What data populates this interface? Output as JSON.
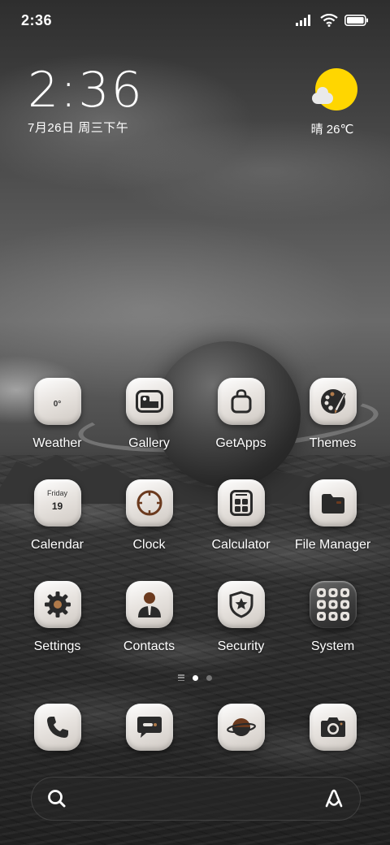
{
  "status_bar": {
    "time": "2:36",
    "icons": [
      "signal-icon",
      "wifi-icon",
      "battery-icon"
    ]
  },
  "clock_widget": {
    "time": "2:36",
    "date": "7月26日 周三下午"
  },
  "weather_widget": {
    "text": "晴 26℃",
    "icon": "sun-cloud-icon"
  },
  "apps": [
    {
      "label": "Weather",
      "icon": "weather-icon",
      "icon_text": "0°"
    },
    {
      "label": "Gallery",
      "icon": "gallery-icon"
    },
    {
      "label": "GetApps",
      "icon": "shopping-bag-icon"
    },
    {
      "label": "Themes",
      "icon": "palette-icon"
    },
    {
      "label": "Calendar",
      "icon": "calendar-icon",
      "day": "Friday",
      "date": "19"
    },
    {
      "label": "Clock",
      "icon": "clock-icon"
    },
    {
      "label": "Calculator",
      "icon": "calculator-icon"
    },
    {
      "label": "File Manager",
      "icon": "folder-icon"
    },
    {
      "label": "Settings",
      "icon": "gear-icon"
    },
    {
      "label": "Contacts",
      "icon": "person-icon"
    },
    {
      "label": "Security",
      "icon": "shield-star-icon"
    },
    {
      "label": "System",
      "icon": "app-folder-icon"
    }
  ],
  "page_indicator": {
    "pages": 2,
    "active": 0
  },
  "dock": [
    {
      "name": "phone",
      "icon": "phone-icon"
    },
    {
      "name": "messages",
      "icon": "message-icon"
    },
    {
      "name": "browser",
      "icon": "planet-icon"
    },
    {
      "name": "camera",
      "icon": "camera-icon"
    }
  ],
  "search_bar": {
    "left_icon": "search-icon",
    "right_icon": "assistant-icon"
  },
  "colors": {
    "sun": "#ffd600",
    "icon_glyph": "#2a2a2a",
    "icon_accent": "#6b3a1e"
  }
}
